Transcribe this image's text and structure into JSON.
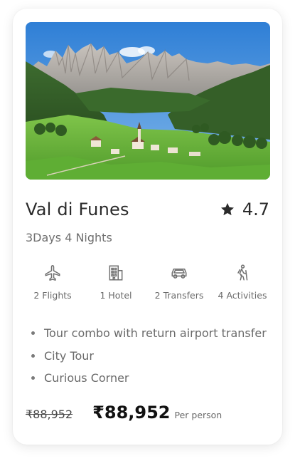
{
  "package": {
    "title": "Val di Funes",
    "rating": "4.7",
    "duration": "3Days 4 Nights",
    "image_alt": "Mountain valley with village"
  },
  "features": [
    {
      "icon": "airplane-icon",
      "label": "2 Flights"
    },
    {
      "icon": "hotel-icon",
      "label": "1 Hotel"
    },
    {
      "icon": "car-icon",
      "label": "2 Transfers"
    },
    {
      "icon": "hiking-icon",
      "label": "4 Activities"
    }
  ],
  "highlights": [
    "Tour combo with return airport transfer",
    "City Tour",
    "Curious Corner"
  ],
  "pricing": {
    "old_price": "₹88,952",
    "new_price": "₹88,952",
    "per_person": "Per person"
  },
  "colors": {
    "text_dark": "#2b2b2b",
    "text_muted": "#6a6a6a",
    "icon_gray": "#707070"
  }
}
